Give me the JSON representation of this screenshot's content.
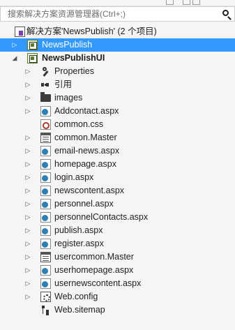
{
  "search": {
    "placeholder": "搜索解决方案资源管理器(Ctrl+;)"
  },
  "solution": {
    "label": "解决方案'NewsPublish' (2 个项目)",
    "icon": "solution-icon"
  },
  "projects": [
    {
      "label": "NewsPublish",
      "selected": true,
      "expanded": false
    },
    {
      "label": "NewsPublishUI",
      "selected": false,
      "expanded": true
    }
  ],
  "items": [
    {
      "label": "Properties",
      "icon": "wrench-icon",
      "expandable": true
    },
    {
      "label": "引用",
      "icon": "references-icon",
      "expandable": true
    },
    {
      "label": "images",
      "icon": "folder-icon",
      "expandable": true
    },
    {
      "label": "Addcontact.aspx",
      "icon": "aspx-file-icon",
      "expandable": true
    },
    {
      "label": "common.css",
      "icon": "css-file-icon",
      "expandable": false
    },
    {
      "label": "common.Master",
      "icon": "master-file-icon",
      "expandable": true
    },
    {
      "label": "email-news.aspx",
      "icon": "aspx-file-icon",
      "expandable": true
    },
    {
      "label": "homepage.aspx",
      "icon": "aspx-file-icon",
      "expandable": true
    },
    {
      "label": "login.aspx",
      "icon": "aspx-file-icon",
      "expandable": true
    },
    {
      "label": "newscontent.aspx",
      "icon": "aspx-file-icon",
      "expandable": true
    },
    {
      "label": "personnel.aspx",
      "icon": "aspx-file-icon",
      "expandable": true
    },
    {
      "label": "personnelContacts.aspx",
      "icon": "aspx-file-icon",
      "expandable": true
    },
    {
      "label": "publish.aspx",
      "icon": "aspx-file-icon",
      "expandable": true
    },
    {
      "label": "register.aspx",
      "icon": "aspx-file-icon",
      "expandable": true
    },
    {
      "label": "usercommon.Master",
      "icon": "master-file-icon",
      "expandable": true
    },
    {
      "label": "userhomepage.aspx",
      "icon": "aspx-file-icon",
      "expandable": true
    },
    {
      "label": "usernewscontent.aspx",
      "icon": "aspx-file-icon",
      "expandable": true
    },
    {
      "label": "Web.config",
      "icon": "config-file-icon",
      "expandable": true
    },
    {
      "label": "Web.sitemap",
      "icon": "sitemap-icon",
      "expandable": false
    }
  ],
  "colors": {
    "selection": "#3399ff",
    "background": "#f5f5f5"
  }
}
